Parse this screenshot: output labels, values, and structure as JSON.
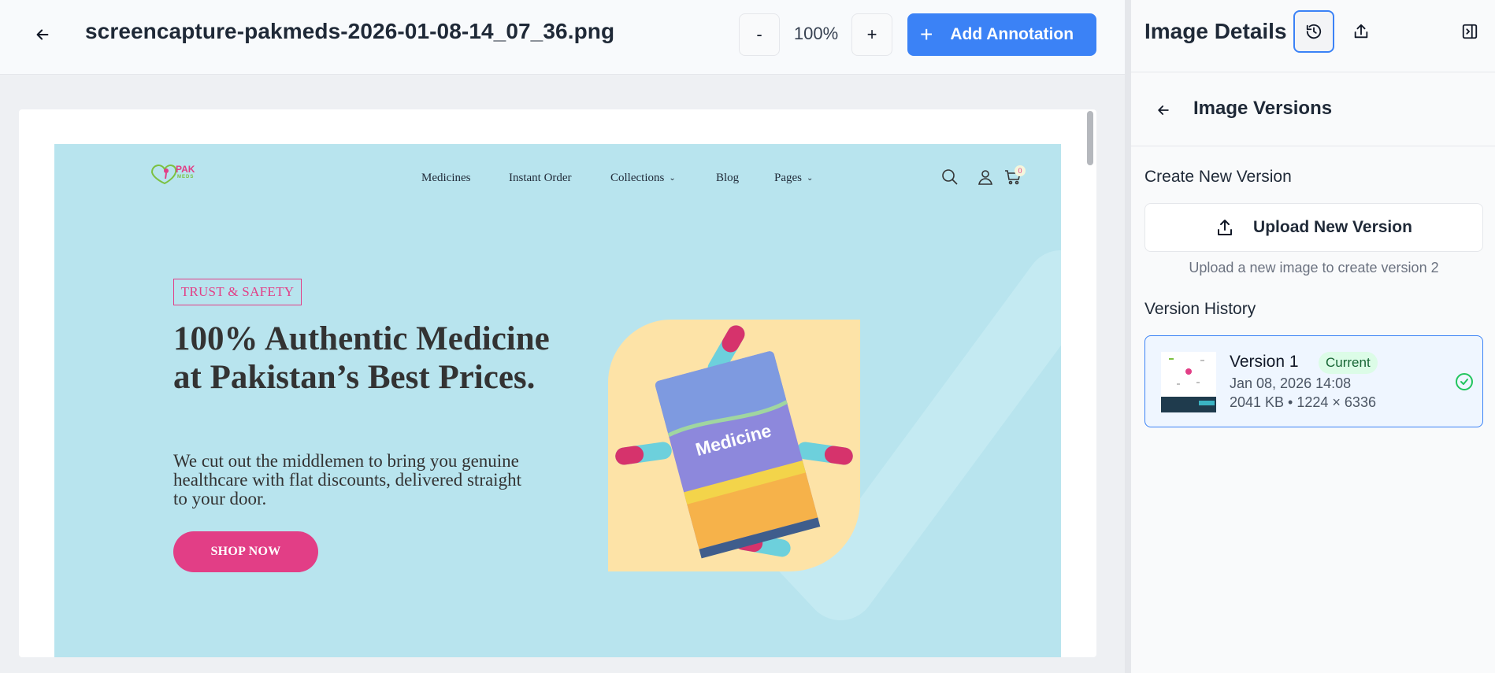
{
  "viewer": {
    "file_name": "screencapture-pakmeds-2026-01-08-14_07_36.png",
    "zoom_minus": "-",
    "zoom_level": "100%",
    "zoom_plus": "+",
    "add_annotation_label": "Add Annotation",
    "accent": "#3b82f6"
  },
  "capture": {
    "background": "#b8e4ee",
    "logo_text": "PAK",
    "logo_sub": "MEDS",
    "nav": {
      "medicines": "Medicines",
      "instant_order": "Instant Order",
      "collections": "Collections",
      "blog": "Blog",
      "pages": "Pages"
    },
    "cart_count": "0",
    "tagline": "TRUST & SAFETY",
    "hero_title": "100% Authentic Medicine at Pakistan’s Best Prices.",
    "hero_sub": "We cut out the middlemen to bring you genuine healthcare with flat discounts, delivered straight to your door.",
    "cta": "SHOP NOW",
    "product_label": "Medicine",
    "brand_pink": "#e23e86"
  },
  "panel": {
    "title": "Image Details",
    "versions_title": "Image Versions",
    "create_label": "Create New Version",
    "upload_label": "Upload New Version",
    "upload_hint": "Upload a new image to create version 2",
    "history_label": "Version History",
    "versions": [
      {
        "name": "Version 1",
        "badge": "Current",
        "date": "Jan 08, 2026 14:08",
        "meta": "2041 KB • 1224 × 6336"
      }
    ]
  },
  "icons": [
    "back-arrow-icon",
    "plus-icon",
    "history-icon",
    "share-icon",
    "collapse-panel-icon",
    "upload-icon",
    "check-circle-icon",
    "search-icon",
    "user-icon",
    "cart-icon"
  ]
}
